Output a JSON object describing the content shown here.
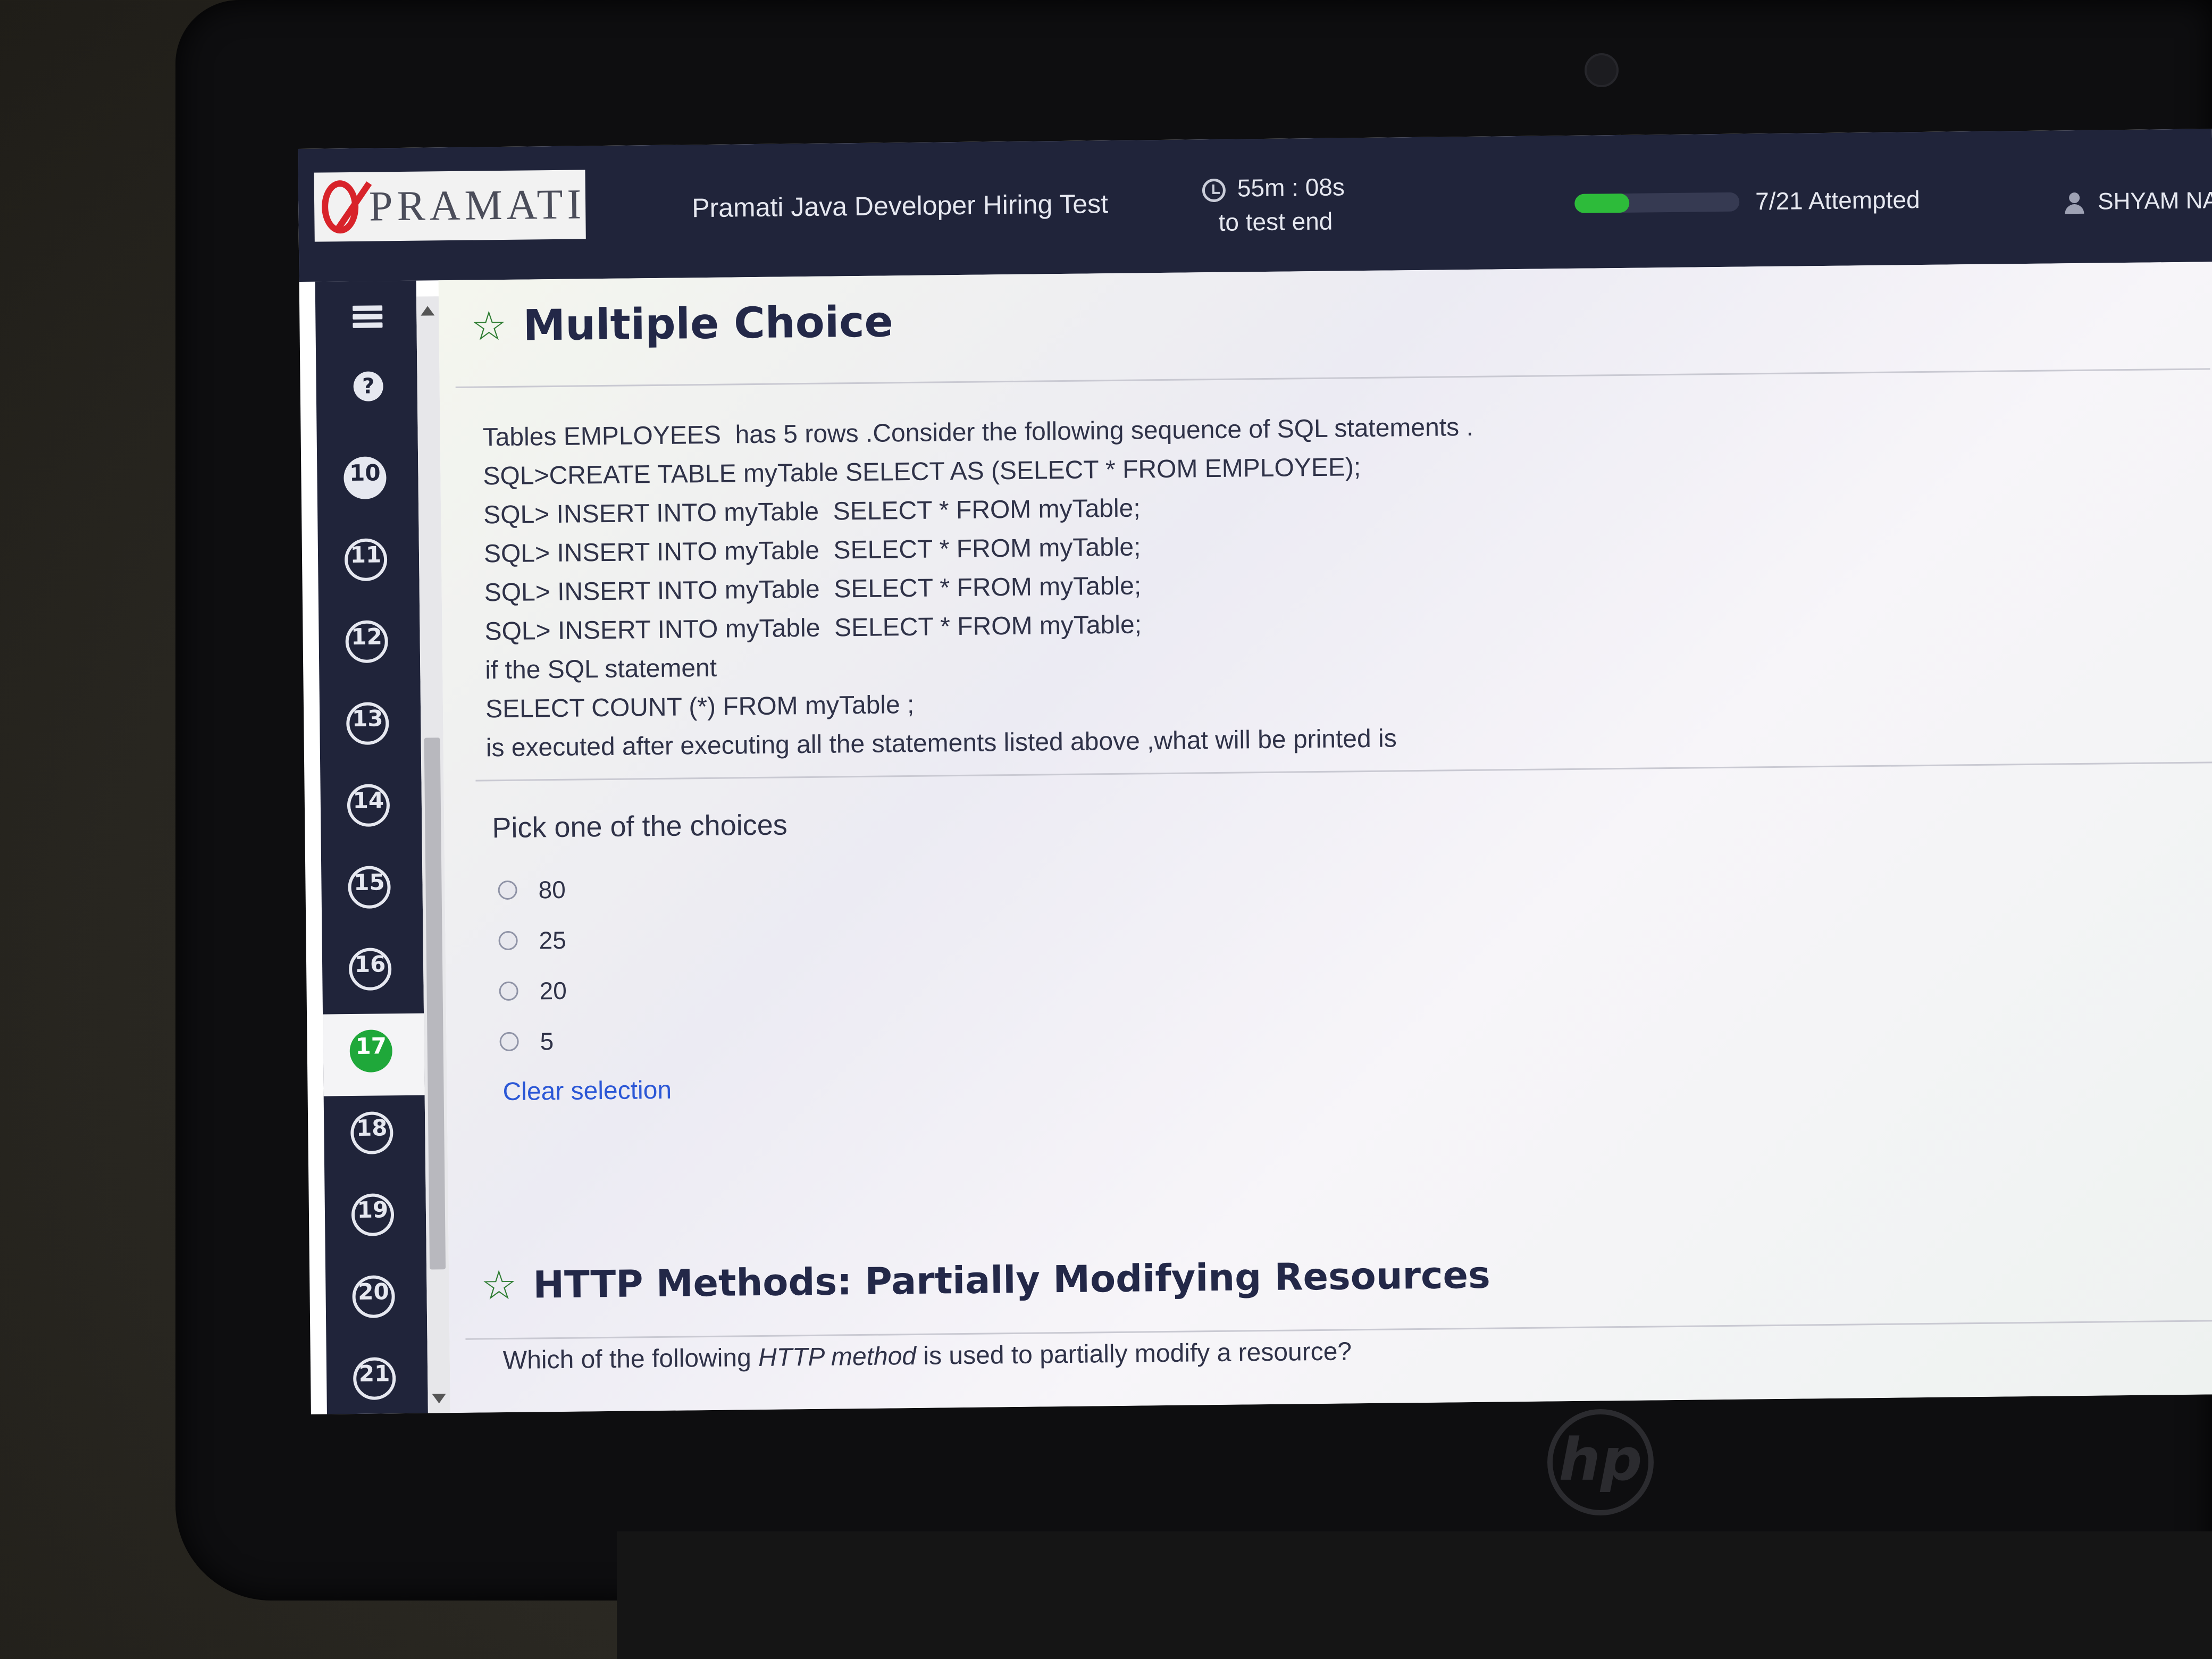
{
  "header": {
    "logo_text": "PRAMATI",
    "test_title": "Pramati Java Developer Hiring Test",
    "timer_value": "55m : 08s",
    "timer_label": "to test end",
    "progress_fraction": 0.333,
    "attempted": "7/21 Attempted",
    "user_name": "SHYAM NAYA"
  },
  "sidebar": {
    "questions": [
      {
        "number": "10"
      },
      {
        "number": "11"
      },
      {
        "number": "12"
      },
      {
        "number": "13"
      },
      {
        "number": "14"
      },
      {
        "number": "15"
      },
      {
        "number": "16"
      },
      {
        "number": "17"
      },
      {
        "number": "18"
      },
      {
        "number": "19"
      },
      {
        "number": "20"
      },
      {
        "number": "21"
      }
    ],
    "active_question": "17"
  },
  "question1": {
    "type_title": "Multiple Choice",
    "lines": [
      "Tables EMPLOYEES  has 5 rows .Consider the following sequence of SQL statements .",
      "SQL>CREATE TABLE myTable SELECT AS (SELECT * FROM EMPLOYEE);",
      "SQL> INSERT INTO myTable  SELECT * FROM myTable;",
      "SQL> INSERT INTO myTable  SELECT * FROM myTable;",
      "SQL> INSERT INTO myTable  SELECT * FROM myTable;",
      "SQL> INSERT INTO myTable  SELECT * FROM myTable;",
      "if the SQL statement",
      "SELECT COUNT (*) FROM myTable ;",
      "is executed after executing all the statements listed above ,what will be printed is"
    ],
    "pick_label": "Pick one of the choices",
    "choices": [
      "80",
      "25",
      "20",
      "5"
    ],
    "clear_label": "Clear selection"
  },
  "question2": {
    "title": "HTTP Methods: Partially Modifying Resources",
    "text_before": "Which of the following ",
    "text_emphasis": "HTTP method",
    "text_after": " is used to partially modify a resource?"
  },
  "device": {
    "brand_logo": "hp"
  }
}
